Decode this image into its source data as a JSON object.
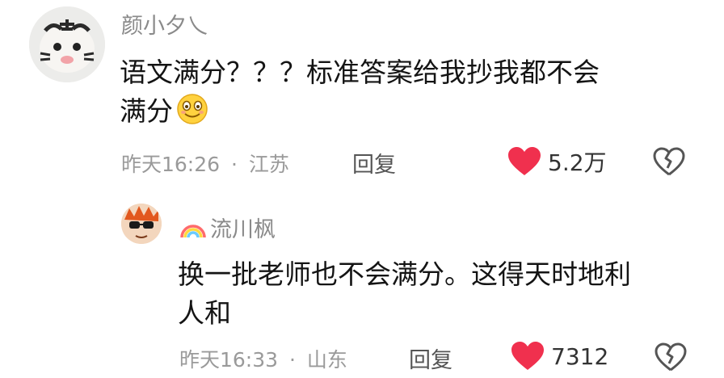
{
  "comments": [
    {
      "username": "颜小夕乀",
      "text_line1": "语文满分？？？标准答案给我抄我都不会",
      "text_line2": "满分",
      "text_emoji": "smiling-face-emoji",
      "time": "昨天16:26",
      "location": "江苏",
      "reply_label": "回复",
      "like_count": "5.2万",
      "avatar_icon": "tiger-avatar"
    },
    {
      "username": "流川枫",
      "username_badge_icon": "rainbow-icon",
      "text_line1": "换一批老师也不会满分。这得天时地利",
      "text_line2": "人和",
      "time": "昨天16:33",
      "location": "山东",
      "reply_label": "回复",
      "like_count": "7312",
      "avatar_icon": "cartoon-sunglasses-avatar"
    }
  ],
  "separator": "·",
  "colors": {
    "like_heart": "#f0304e",
    "meta_gray": "#9a9a9a",
    "username_gray": "#8a8a8a"
  }
}
